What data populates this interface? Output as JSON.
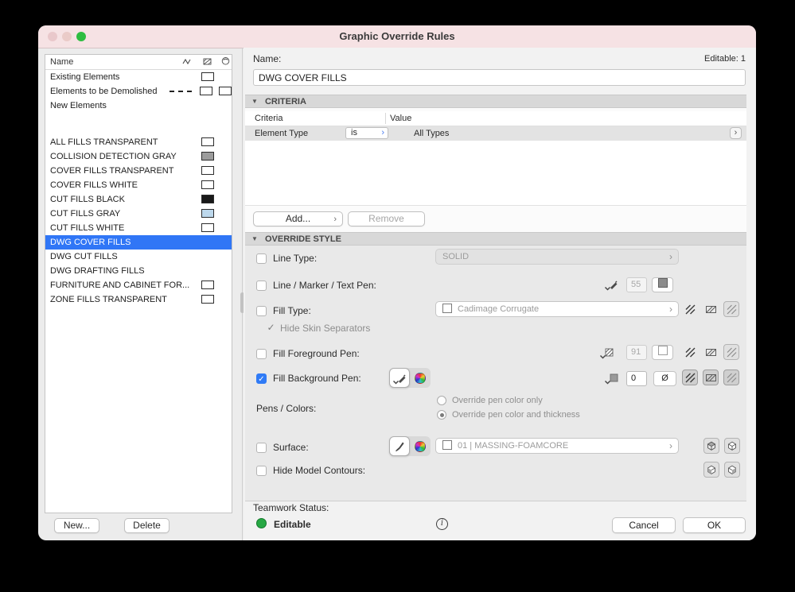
{
  "window": {
    "title": "Graphic Override Rules"
  },
  "colors": {
    "selection_blue": "#3076f6",
    "checkbox_blue": "#307bf6",
    "teamwork_green": "#27a844",
    "titlebar_pink": "#f6e2e4"
  },
  "left": {
    "header": {
      "name": "Name"
    },
    "items": [
      {
        "label": "Existing Elements",
        "swatch": "#ffffff"
      },
      {
        "label": "Elements to be Demolished",
        "swatch": "#ffffff",
        "swatch2": "#ffffff"
      },
      {
        "label": "New Elements"
      },
      {
        "label": "ALL FILLS TRANSPARENT",
        "swatch": "#ffffff"
      },
      {
        "label": "COLLISION DETECTION GRAY",
        "swatch": "#9c9c9c"
      },
      {
        "label": "COVER FILLS TRANSPARENT",
        "swatch": "#ffffff"
      },
      {
        "label": "COVER FILLS WHITE",
        "swatch": "#ffffff"
      },
      {
        "label": "CUT FILLS BLACK",
        "swatch": "#191919"
      },
      {
        "label": "CUT FILLS GRAY",
        "swatch": "#bdd8ec"
      },
      {
        "label": "CUT FILLS WHITE",
        "swatch": "#ffffff"
      },
      {
        "label": "DWG COVER FILLS",
        "selected": true
      },
      {
        "label": "DWG CUT FILLS"
      },
      {
        "label": "DWG DRAFTING FILLS"
      },
      {
        "label": "FURNITURE AND CABINET FOR...",
        "swatch": "#ffffff"
      },
      {
        "label": "ZONE FILLS TRANSPARENT",
        "swatch": "#ffffff"
      }
    ],
    "new_button": "New...",
    "delete_button": "Delete"
  },
  "name_section": {
    "label": "Name:",
    "editable": "Editable: 1",
    "value": "DWG COVER FILLS"
  },
  "criteria": {
    "title": "CRITERIA",
    "columns": {
      "criteria": "Criteria",
      "value": "Value"
    },
    "row": {
      "name": "Element Type",
      "operator": "is",
      "value": "All Types"
    },
    "add_button": "Add...",
    "remove_button": "Remove"
  },
  "override": {
    "title": "OVERRIDE STYLE",
    "line_type": {
      "label": "Line Type:",
      "value": "SOLID"
    },
    "line_pen": {
      "label": "Line / Marker / Text Pen:",
      "pen": "55"
    },
    "fill_type": {
      "label": "Fill Type:",
      "value": "Cadimage Corrugate"
    },
    "hide_skin": {
      "label": "Hide Skin Separators"
    },
    "fill_fg_pen": {
      "label": "Fill Foreground Pen:",
      "pen": "91"
    },
    "fill_bg_pen": {
      "label": "Fill Background Pen:",
      "pen": "0",
      "null_pen": "Ø"
    },
    "pens_colors": {
      "label": "Pens / Colors:",
      "option_color_only": "Override pen color only",
      "option_color_thickness": "Override pen color and thickness"
    },
    "surface": {
      "label": "Surface:",
      "value": "01 | MASSING-FOAMCORE"
    },
    "hide_contours": {
      "label": "Hide Model Contours:"
    }
  },
  "teamwork": {
    "label": "Teamwork Status:",
    "status": "Editable"
  },
  "actions": {
    "cancel": "Cancel",
    "ok": "OK"
  }
}
